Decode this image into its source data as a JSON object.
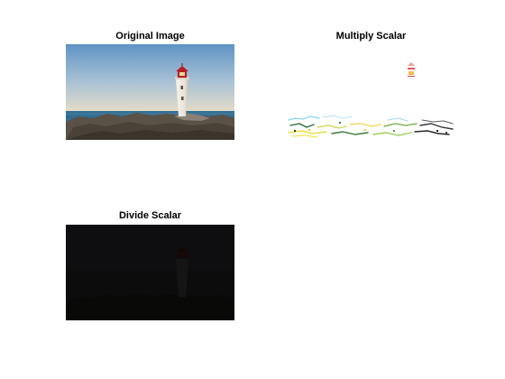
{
  "panels": [
    {
      "title": "Original Image"
    },
    {
      "title": "Multiply Scalar"
    },
    {
      "title": "Divide Scalar"
    }
  ],
  "colors": {
    "figure_background": "#ffffff",
    "sky_top": "#5f93c4",
    "sky_bottom": "#e7dcc7",
    "sea": "#356f93",
    "rocks": "#5a5147",
    "lighthouse_tower": "#f4f2ee",
    "lantern_red": "#b51e24",
    "divided_image": "#0c0c0c"
  }
}
